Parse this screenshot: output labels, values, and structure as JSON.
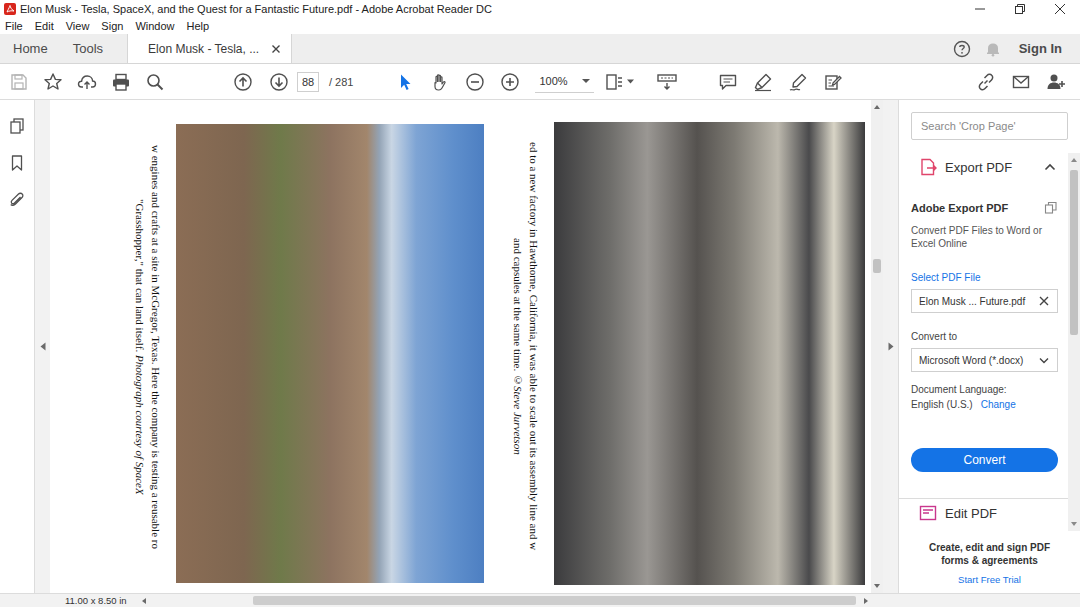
{
  "window": {
    "title": "Elon Musk - Tesla, SpaceX, and the Quest for a Fantastic Future.pdf - Adobe Acrobat Reader DC"
  },
  "menu": [
    "File",
    "Edit",
    "View",
    "Sign",
    "Window",
    "Help"
  ],
  "tabs": [
    {
      "label": "Home",
      "selected": false
    },
    {
      "label": "Tools",
      "selected": false
    },
    {
      "label": "Elon Musk - Tesla, ...",
      "selected": true
    }
  ],
  "account": {
    "label": "Sign In"
  },
  "toolbar": {
    "save": {
      "disabled": true
    },
    "page": "88",
    "total": "/ 281",
    "zoom": "100%",
    "pointer_tools": [
      {
        "kind": "select",
        "selected": true
      },
      {
        "kind": "hand",
        "selected": false
      }
    ]
  },
  "document": {
    "panels": [
      {
        "kind": "outdoor",
        "lines": [
          [
            {
              "text": "w engines and crafts at a site in McGregor, Texas. Here the company is testing a reusable ro",
              "italic": false
            }
          ],
          [
            {
              "text": "\"Grasshopper,\" that can land itself. ",
              "italic": false
            },
            {
              "text": "Photograph courtesy of SpaceX",
              "italic": true
            }
          ]
        ]
      },
      {
        "kind": "indoor",
        "lines": [
          [
            {
              "text": "ed to a new factory in Hawthorne, California, it was able to scale out its assembly line and w",
              "italic": false
            }
          ],
          [
            {
              "text": "and capsules at the same time. ",
              "italic": false
            },
            {
              "text": "©Steve Jurvetson",
              "italic": true
            }
          ]
        ]
      }
    ]
  },
  "right_panel": {
    "search": {
      "placeholder": "Search 'Crop Page'"
    },
    "tools": [
      {
        "label": "Export PDF",
        "expanded": true
      },
      {
        "label": "Edit PDF",
        "expanded": false
      }
    ],
    "export": {
      "heading": "Adobe Export PDF",
      "description": "Convert PDF Files to Word or Excel Online",
      "select_label": "Select PDF File",
      "file": "Elon Musk ... Future.pdf",
      "convert_label": "Convert to",
      "format": "Microsoft Word (*.docx)",
      "language_label": "Document Language:",
      "language": "English (U.S.)",
      "change": "Change",
      "button": "Convert"
    },
    "promo": {
      "text": "Create, edit and sign PDF forms & agreements",
      "link": "Start Free Trial"
    }
  },
  "status_bar": {
    "page_size": "11.00 x 8.50 in"
  }
}
